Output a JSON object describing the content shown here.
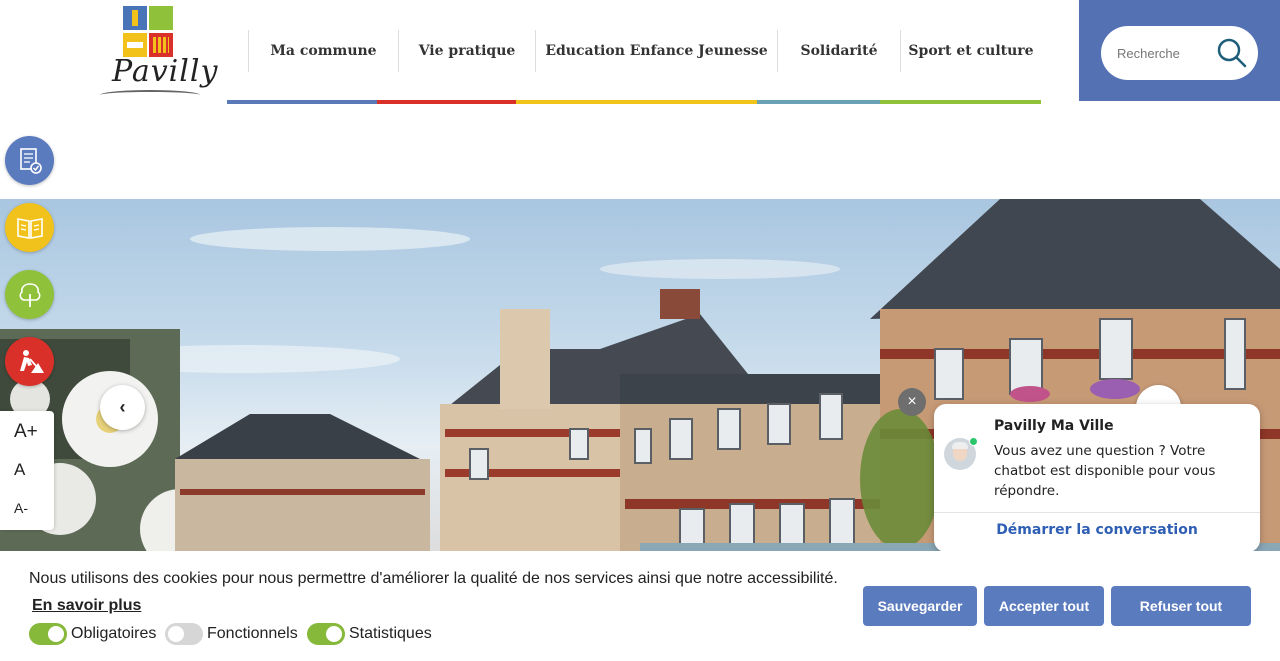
{
  "logo": {
    "text": "Pavilly"
  },
  "nav": {
    "items": [
      {
        "label": "Ma commune"
      },
      {
        "label": "Vie pratique"
      },
      {
        "label": "Education Enfance Jeunesse"
      },
      {
        "label": "Solidarité"
      },
      {
        "label": "Sport et culture"
      }
    ],
    "colors": [
      "#5a79b9",
      "#d9302a",
      "#f0c419",
      "#6aa1b6",
      "#8fc13a"
    ]
  },
  "search": {
    "placeholder": "Recherche",
    "icon": "search-icon"
  },
  "shortcuts": [
    {
      "icon": "document-check-icon",
      "color": "#5b7bbf"
    },
    {
      "icon": "open-book-icon",
      "color": "#f1c21c"
    },
    {
      "icon": "tree-icon",
      "color": "#8fc13a"
    },
    {
      "icon": "roadworks-icon",
      "color": "#d9302a"
    }
  ],
  "slider": {
    "prev": "‹",
    "next": "›"
  },
  "font_tools": {
    "increase": "A+",
    "reset": "A",
    "decrease": "A-"
  },
  "chatbot": {
    "close": "×",
    "title": "Pavilly Ma Ville",
    "message": "Vous avez une question ? Votre chatbot est disponible pour vous répondre.",
    "cta": "Démarrer la conversation"
  },
  "cookies": {
    "message": "Nous utilisons des cookies pour nous permettre d'améliorer la qualité de nos services ainsi que notre accessibilité.",
    "learn_more": "En savoir plus",
    "toggles": [
      {
        "label": "Obligatoires",
        "on": true
      },
      {
        "label": "Fonctionnels",
        "on": false
      },
      {
        "label": "Statistiques",
        "on": true
      }
    ],
    "buttons": {
      "save": "Sauvegarder",
      "accept": "Accepter tout",
      "refuse": "Refuser tout"
    }
  }
}
